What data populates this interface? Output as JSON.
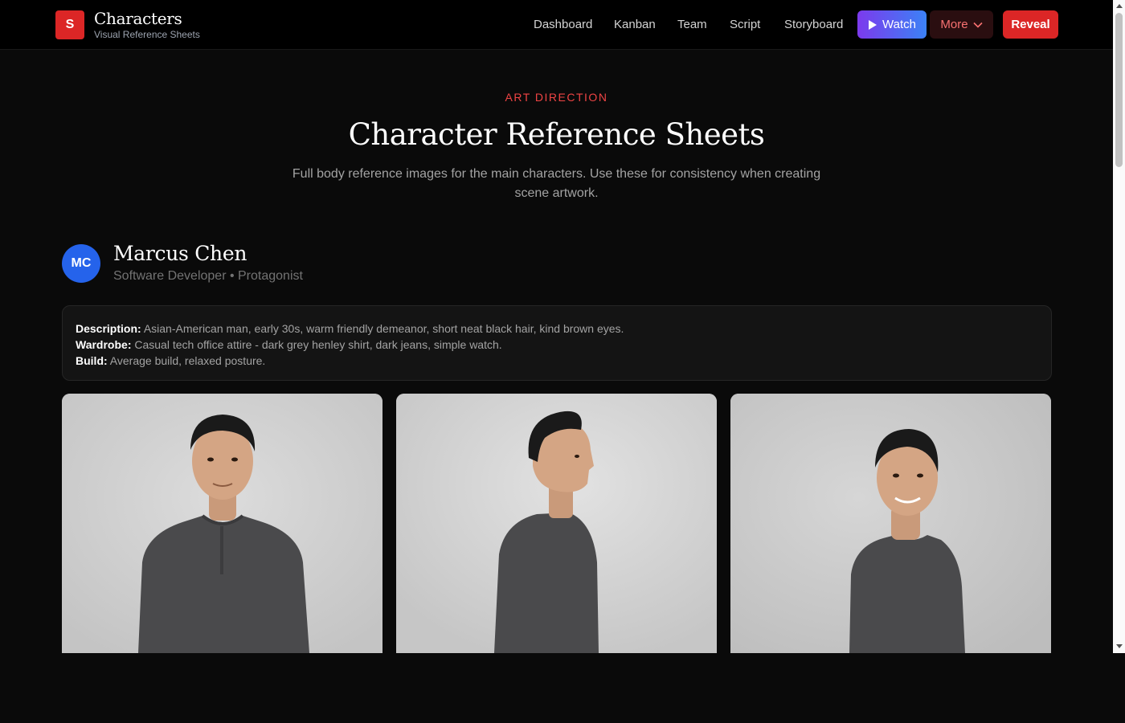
{
  "header": {
    "logo_letter": "S",
    "title": "Characters",
    "subtitle": "Visual Reference Sheets",
    "nav": [
      "Dashboard",
      "Kanban",
      "Team",
      "Script",
      "Storyboard"
    ],
    "watch_label": "Watch",
    "more_label": "More",
    "reveal_label": "Reveal"
  },
  "hero": {
    "eyebrow": "ART DIRECTION",
    "title": "Character Reference Sheets",
    "description": "Full body reference images for the main characters. Use these for consistency when creating scene artwork."
  },
  "character": {
    "initials": "MC",
    "name": "Marcus Chen",
    "role": "Software Developer • Protagonist",
    "details": {
      "description_label": "Description:",
      "description": "Asian-American man, early 30s, warm friendly demeanor, short neat black hair, kind brown eyes.",
      "wardrobe_label": "Wardrobe:",
      "wardrobe": "Casual tech office attire - dark grey henley shirt, dark jeans, simple watch.",
      "build_label": "Build:",
      "build": "Average build, relaxed posture."
    },
    "images": [
      "front-view",
      "profile-view",
      "three-quarter-view"
    ]
  },
  "colors": {
    "accent": "#dc2626",
    "avatar": "#2563eb",
    "watch_gradient_start": "#7c3aed",
    "watch_gradient_end": "#3b82f6"
  }
}
